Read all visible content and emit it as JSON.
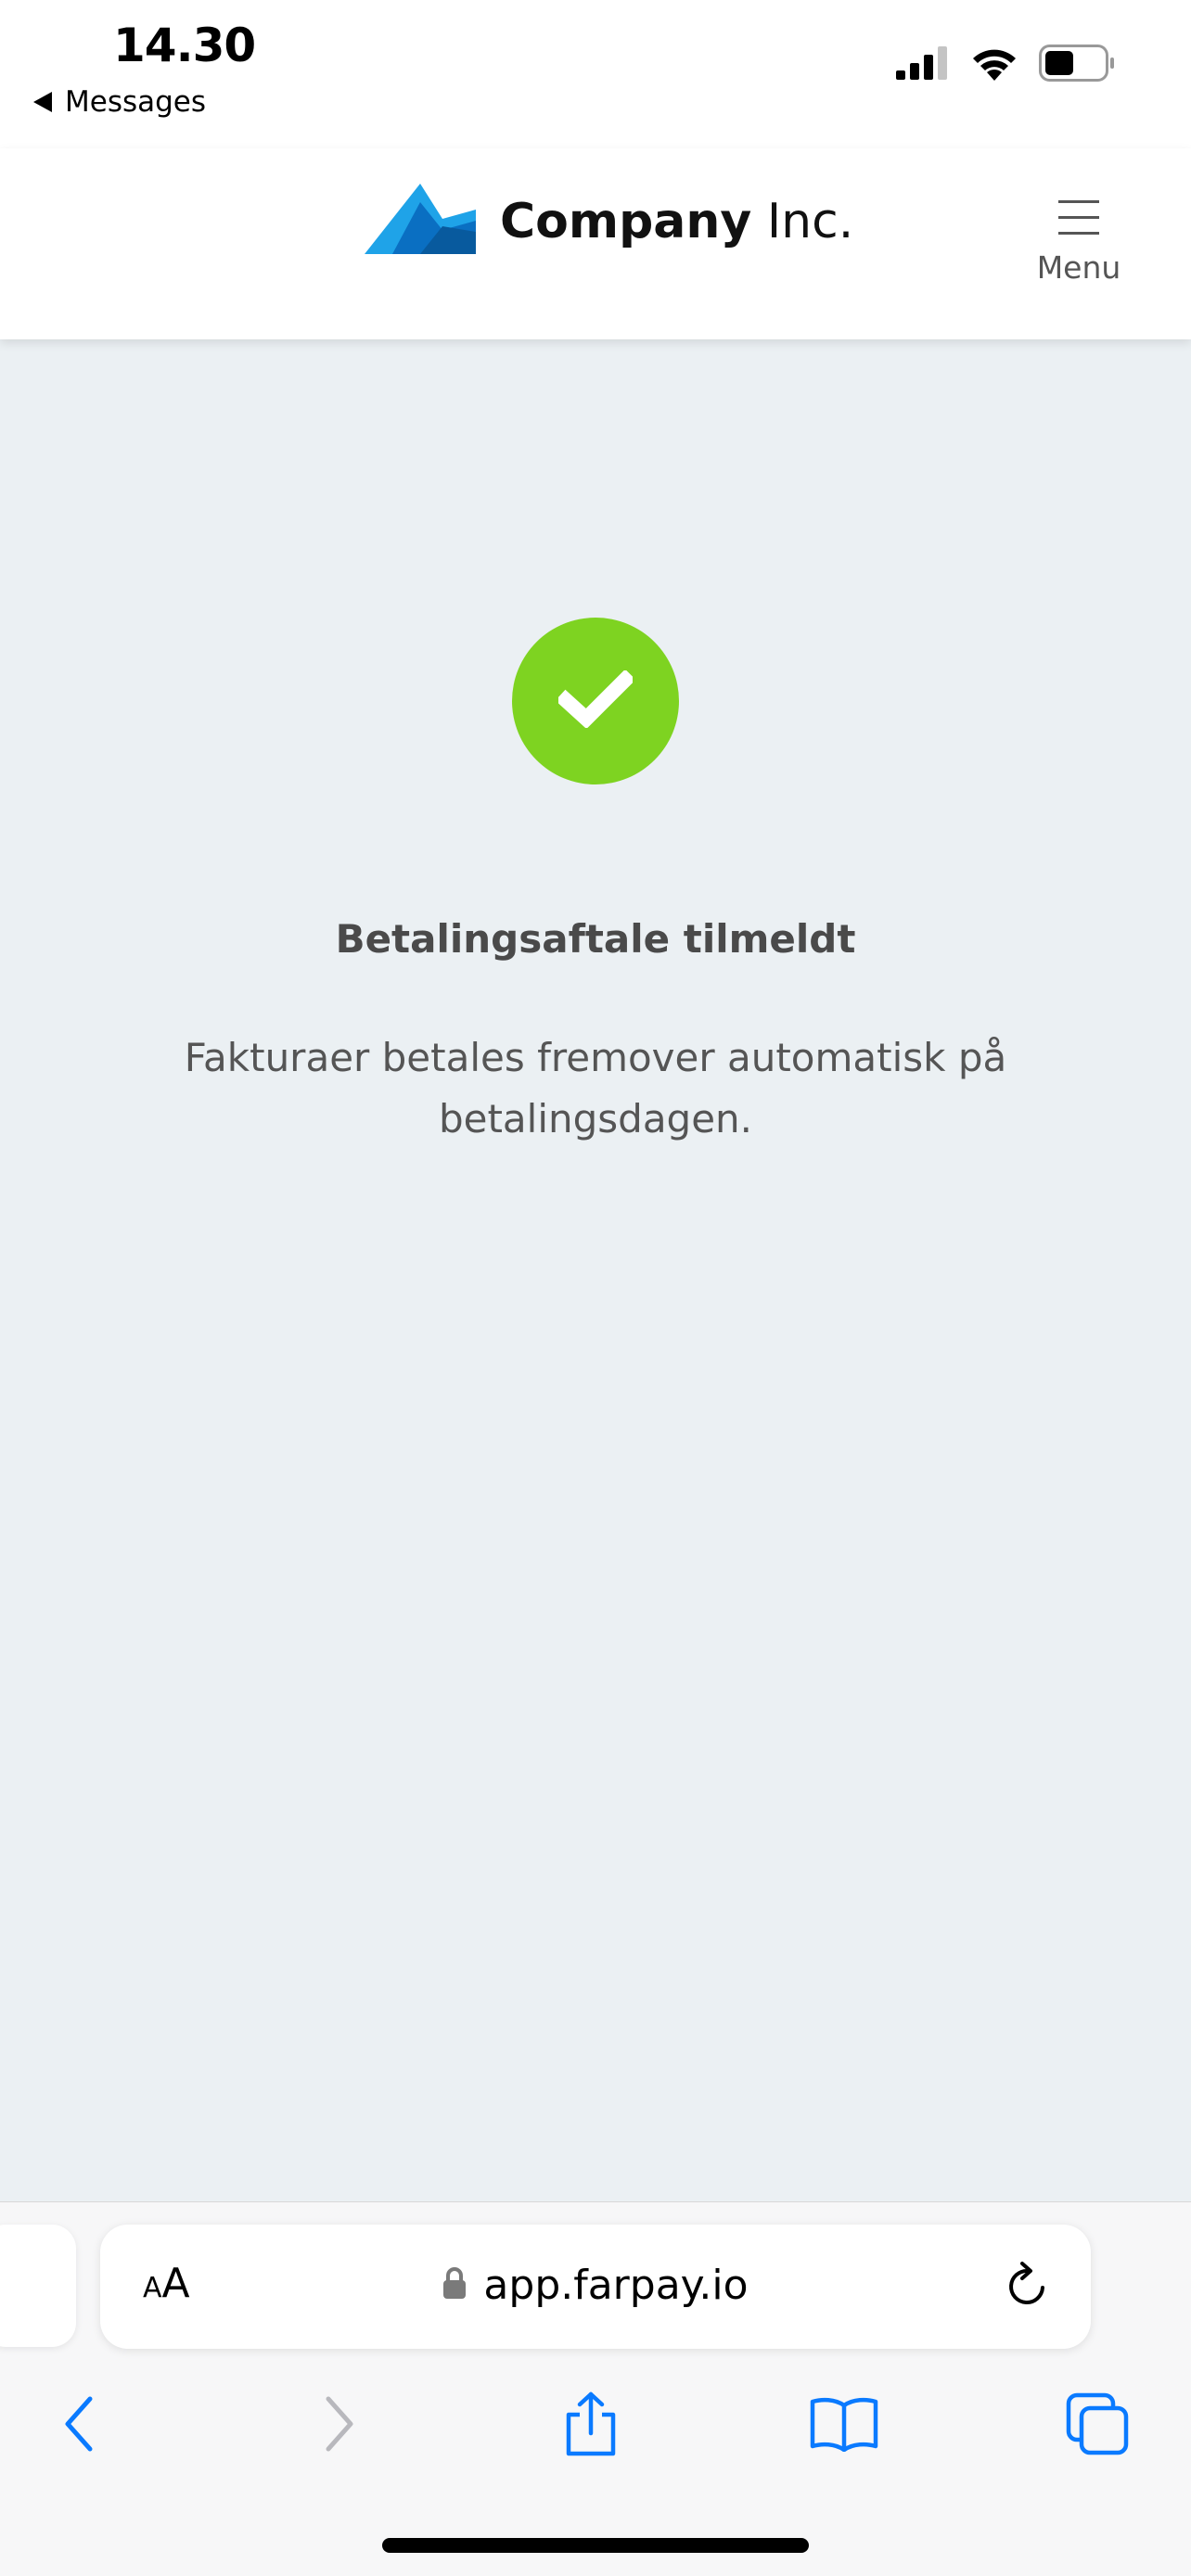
{
  "status_bar": {
    "time": "14.30",
    "back_label": "Messages",
    "icons": [
      "cellular-signal-icon",
      "wifi-icon",
      "battery-icon"
    ]
  },
  "header": {
    "logo_bold": "Company",
    "logo_light": " Inc.",
    "menu_label": "Menu",
    "colors": {
      "logo_blue": "#1fa3e8",
      "logo_dark_blue": "#0a6fc2"
    }
  },
  "main": {
    "status_icon": "checkmark-icon",
    "title": "Betalingsaftale tilmeldt",
    "message": "Fakturaer betales fremover automatisk på betalingsdagen.",
    "colors": {
      "success": "#7ed321",
      "background": "#ebf0f3"
    }
  },
  "browser": {
    "text_size_label_small": "A",
    "text_size_label_big": "A",
    "url": "app.farpay.io",
    "toolbar": [
      "back-icon",
      "forward-icon",
      "share-icon",
      "bookmarks-icon",
      "tabs-icon"
    ],
    "accent": "#0a7aff"
  }
}
